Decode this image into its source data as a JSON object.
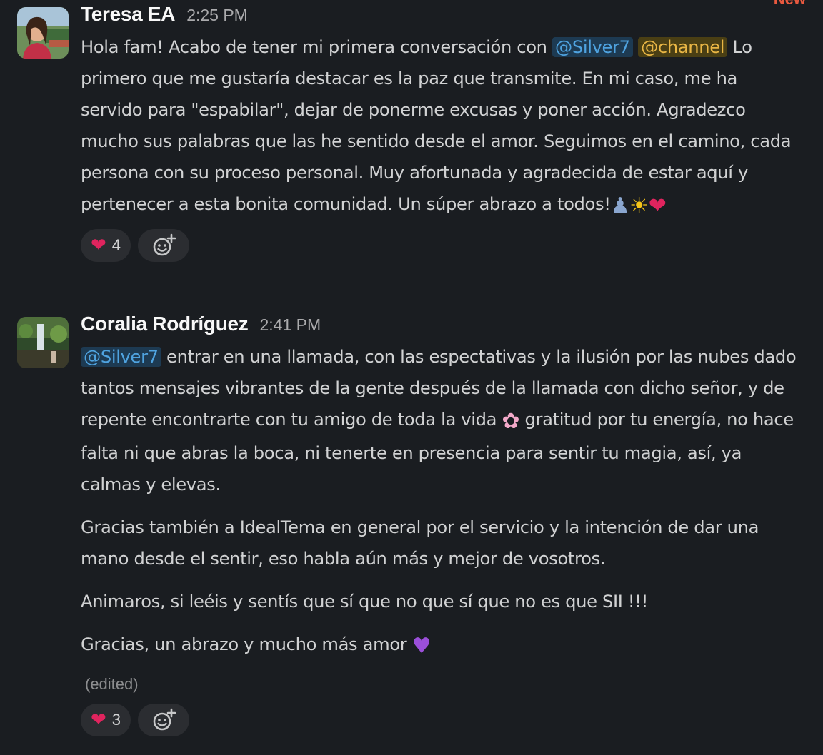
{
  "header": {
    "new_label": "New"
  },
  "messages": [
    {
      "sender": "Teresa EA",
      "time": "2:25 PM",
      "text": {
        "intro": "Hola fam! Acabo de tener mi primera conversación con ",
        "mention": "@Silver7",
        "channel_mention": "@channel",
        "rest": " Lo primero que me gustaría destacar es la paz que transmite. En mi caso, me ha servido para \"espabilar\", dejar de ponerme excusas y poner acción. Agradezco mucho sus palabras que las he sentido desde el amor. Seguimos en el camino, cada persona con su proceso personal. Muy afortunada y agradecida de estar aquí y pertenecer a esta bonita comunidad. Un súper abrazo a todos!"
      },
      "emojis": [
        "people-hugging",
        "sun",
        "red-heart"
      ],
      "reactions": [
        {
          "emoji": "red-heart",
          "glyph": "❤",
          "count": "4"
        }
      ]
    },
    {
      "sender": "Coralia Rodríguez",
      "time": "2:41 PM",
      "paragraphs": {
        "p1_mention": "@Silver7",
        "p1_text": " entrar en una llamada, con las espectativas y la ilusión por  las nubes dado tantos mensajes vibrantes de la gente después de la llamada con dicho señor, y de repente encontrarte con tu amigo de toda la vida ",
        "p1_text_after_emoji": " gratitud por tu energía, no hace falta ni que abras la boca, ni tenerte en presencia para sentir tu magia, así, ya calmas y elevas.",
        "p2": "Gracias también a IdealTema en general por el servicio y la intención de dar una mano desde el sentir, eso habla aún más y mejor de vosotros.",
        "p3": "Animaros, si leéis y sentís que sí que no que sí que no es que SII !!!",
        "p4": "Gracias, un abrazo y mucho más amor "
      },
      "emojis": [
        "cherry-blossom",
        "purple-heart"
      ],
      "edited_label": "(edited)",
      "reactions": [
        {
          "emoji": "red-heart",
          "glyph": "❤",
          "count": "3"
        }
      ]
    }
  ],
  "glyphs": {
    "red_heart": "❤",
    "sun": "☀",
    "hugging": "♟",
    "flower": "✿",
    "purple_heart": "♥"
  }
}
